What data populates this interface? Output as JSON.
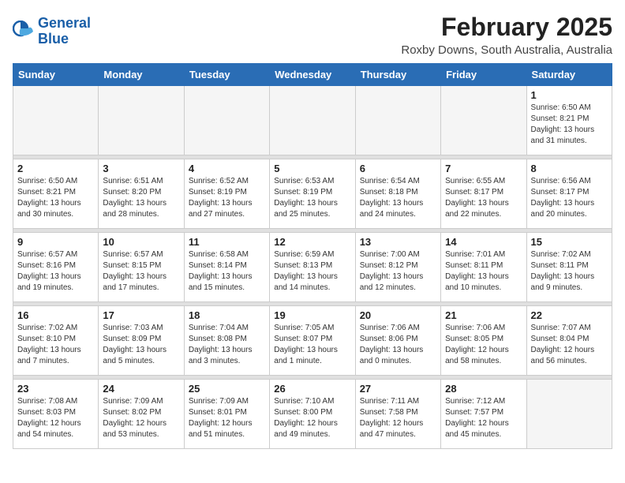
{
  "header": {
    "logo_line1": "General",
    "logo_line2": "Blue",
    "month_title": "February 2025",
    "location": "Roxby Downs, South Australia, Australia"
  },
  "weekdays": [
    "Sunday",
    "Monday",
    "Tuesday",
    "Wednesday",
    "Thursday",
    "Friday",
    "Saturday"
  ],
  "weeks": [
    [
      {
        "day": "",
        "info": ""
      },
      {
        "day": "",
        "info": ""
      },
      {
        "day": "",
        "info": ""
      },
      {
        "day": "",
        "info": ""
      },
      {
        "day": "",
        "info": ""
      },
      {
        "day": "",
        "info": ""
      },
      {
        "day": "1",
        "info": "Sunrise: 6:50 AM\nSunset: 8:21 PM\nDaylight: 13 hours\nand 31 minutes."
      }
    ],
    [
      {
        "day": "2",
        "info": "Sunrise: 6:50 AM\nSunset: 8:21 PM\nDaylight: 13 hours\nand 30 minutes."
      },
      {
        "day": "3",
        "info": "Sunrise: 6:51 AM\nSunset: 8:20 PM\nDaylight: 13 hours\nand 28 minutes."
      },
      {
        "day": "4",
        "info": "Sunrise: 6:52 AM\nSunset: 8:19 PM\nDaylight: 13 hours\nand 27 minutes."
      },
      {
        "day": "5",
        "info": "Sunrise: 6:53 AM\nSunset: 8:19 PM\nDaylight: 13 hours\nand 25 minutes."
      },
      {
        "day": "6",
        "info": "Sunrise: 6:54 AM\nSunset: 8:18 PM\nDaylight: 13 hours\nand 24 minutes."
      },
      {
        "day": "7",
        "info": "Sunrise: 6:55 AM\nSunset: 8:17 PM\nDaylight: 13 hours\nand 22 minutes."
      },
      {
        "day": "8",
        "info": "Sunrise: 6:56 AM\nSunset: 8:17 PM\nDaylight: 13 hours\nand 20 minutes."
      }
    ],
    [
      {
        "day": "9",
        "info": "Sunrise: 6:57 AM\nSunset: 8:16 PM\nDaylight: 13 hours\nand 19 minutes."
      },
      {
        "day": "10",
        "info": "Sunrise: 6:57 AM\nSunset: 8:15 PM\nDaylight: 13 hours\nand 17 minutes."
      },
      {
        "day": "11",
        "info": "Sunrise: 6:58 AM\nSunset: 8:14 PM\nDaylight: 13 hours\nand 15 minutes."
      },
      {
        "day": "12",
        "info": "Sunrise: 6:59 AM\nSunset: 8:13 PM\nDaylight: 13 hours\nand 14 minutes."
      },
      {
        "day": "13",
        "info": "Sunrise: 7:00 AM\nSunset: 8:12 PM\nDaylight: 13 hours\nand 12 minutes."
      },
      {
        "day": "14",
        "info": "Sunrise: 7:01 AM\nSunset: 8:11 PM\nDaylight: 13 hours\nand 10 minutes."
      },
      {
        "day": "15",
        "info": "Sunrise: 7:02 AM\nSunset: 8:11 PM\nDaylight: 13 hours\nand 9 minutes."
      }
    ],
    [
      {
        "day": "16",
        "info": "Sunrise: 7:02 AM\nSunset: 8:10 PM\nDaylight: 13 hours\nand 7 minutes."
      },
      {
        "day": "17",
        "info": "Sunrise: 7:03 AM\nSunset: 8:09 PM\nDaylight: 13 hours\nand 5 minutes."
      },
      {
        "day": "18",
        "info": "Sunrise: 7:04 AM\nSunset: 8:08 PM\nDaylight: 13 hours\nand 3 minutes."
      },
      {
        "day": "19",
        "info": "Sunrise: 7:05 AM\nSunset: 8:07 PM\nDaylight: 13 hours\nand 1 minute."
      },
      {
        "day": "20",
        "info": "Sunrise: 7:06 AM\nSunset: 8:06 PM\nDaylight: 13 hours\nand 0 minutes."
      },
      {
        "day": "21",
        "info": "Sunrise: 7:06 AM\nSunset: 8:05 PM\nDaylight: 12 hours\nand 58 minutes."
      },
      {
        "day": "22",
        "info": "Sunrise: 7:07 AM\nSunset: 8:04 PM\nDaylight: 12 hours\nand 56 minutes."
      }
    ],
    [
      {
        "day": "23",
        "info": "Sunrise: 7:08 AM\nSunset: 8:03 PM\nDaylight: 12 hours\nand 54 minutes."
      },
      {
        "day": "24",
        "info": "Sunrise: 7:09 AM\nSunset: 8:02 PM\nDaylight: 12 hours\nand 53 minutes."
      },
      {
        "day": "25",
        "info": "Sunrise: 7:09 AM\nSunset: 8:01 PM\nDaylight: 12 hours\nand 51 minutes."
      },
      {
        "day": "26",
        "info": "Sunrise: 7:10 AM\nSunset: 8:00 PM\nDaylight: 12 hours\nand 49 minutes."
      },
      {
        "day": "27",
        "info": "Sunrise: 7:11 AM\nSunset: 7:58 PM\nDaylight: 12 hours\nand 47 minutes."
      },
      {
        "day": "28",
        "info": "Sunrise: 7:12 AM\nSunset: 7:57 PM\nDaylight: 12 hours\nand 45 minutes."
      },
      {
        "day": "",
        "info": ""
      }
    ]
  ]
}
